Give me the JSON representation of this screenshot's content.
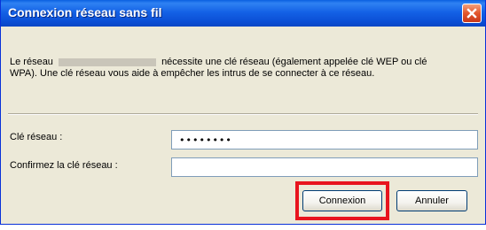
{
  "dialog": {
    "title": "Connexion réseau sans fil",
    "close_icon": "close-icon",
    "description_before": "Le réseau",
    "description_after": "nécessite une clé réseau (également appelée clé WEP ou clé WPA). Une clé réseau vous aide à empêcher les intrus de se connecter à ce réseau."
  },
  "form": {
    "network_key_label": "Clé réseau :",
    "network_key_value": "••••••••",
    "confirm_key_label": "Confirmez la clé réseau :",
    "confirm_key_value": ""
  },
  "buttons": {
    "connect_label": "Connexion",
    "cancel_label": "Annuler"
  },
  "colors": {
    "titlebar": "#0b4fd6",
    "dialog_background": "#ece9d8",
    "highlight": "#e8141e"
  }
}
